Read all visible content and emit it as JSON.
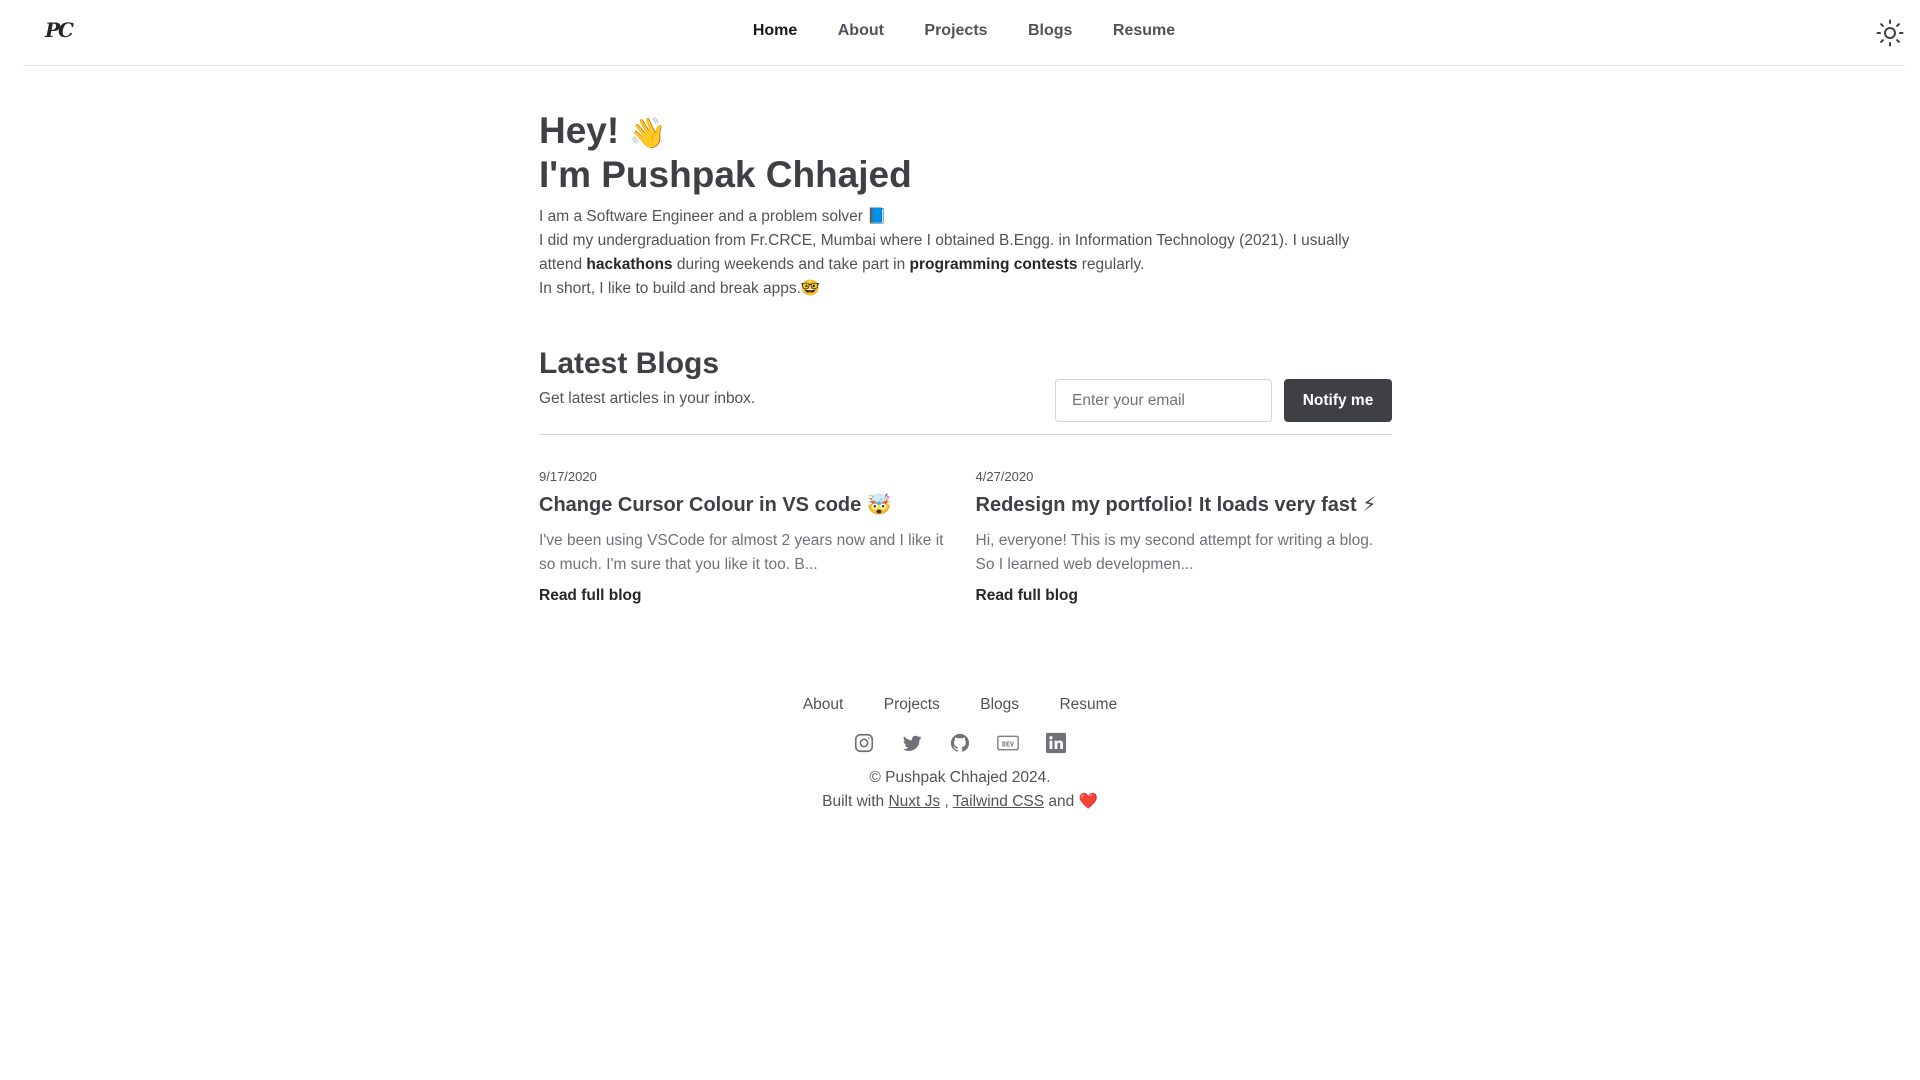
{
  "header": {
    "logo": "PC",
    "nav": [
      {
        "label": "Home",
        "active": true
      },
      {
        "label": "About"
      },
      {
        "label": "Projects"
      },
      {
        "label": "Blogs"
      },
      {
        "label": "Resume"
      }
    ],
    "theme_icon": "sun-icon"
  },
  "hero": {
    "line1": "Hey!",
    "wave": "👋",
    "line2": "I'm Pushpak Chhajed",
    "intro1": "I am a Software Engineer and a problem solver 📘",
    "intro2a": "I did my undergraduation from Fr.CRCE, Mumbai where I obtained B.Engg. in Information Technology (2021). I usually attend ",
    "intro2_hackathons": "hackathons",
    "intro2b": " during weekends and take part in ",
    "intro2_contests": "programming contests",
    "intro2c": " regularly.",
    "intro3": "In short, I like to build and break apps.🤓"
  },
  "blogs": {
    "title": "Latest Blogs",
    "subtitle": "Get latest articles in your inbox.",
    "email_placeholder": "Enter your email",
    "notify_label": "Notify me",
    "posts": [
      {
        "date": "9/17/2020",
        "title": "Change Cursor Colour in VS code 🤯",
        "excerpt": "I've been using VSCode for almost 2 years now and I like it so much. I'm sure that you like it too. B...",
        "read_more": "Read full blog"
      },
      {
        "date": "4/27/2020",
        "title": "Redesign my portfolio! It loads very fast ⚡",
        "excerpt": "Hi, everyone! This is my second attempt for writing a blog. So I learned web developmen...",
        "read_more": "Read full blog"
      }
    ]
  },
  "footer": {
    "nav": [
      "About",
      "Projects",
      "Blogs",
      "Resume"
    ],
    "socials": [
      "instagram-icon",
      "twitter-icon",
      "github-icon",
      "dev-icon",
      "linkedin-icon"
    ],
    "copyright": "© Pushpak Chhajed 2024.",
    "built_prefix": "Built with ",
    "built_nuxt": "Nuxt Js",
    "built_sep": " , ",
    "built_tailwind": "Tailwind CSS",
    "built_and": " and ",
    "heart": "❤️"
  }
}
